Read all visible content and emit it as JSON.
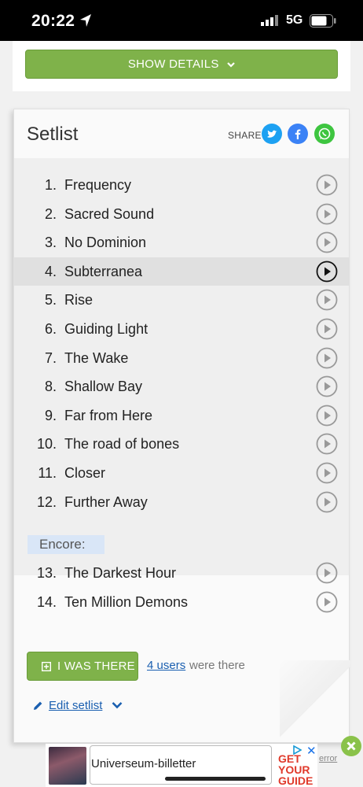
{
  "status_bar": {
    "time": "20:22",
    "network": "5G"
  },
  "show_details": {
    "label": "SHOW DETAILS"
  },
  "setlist": {
    "title": "Setlist",
    "share_label": "SHARE",
    "share_buttons": [
      {
        "name": "twitter",
        "glyph": "t",
        "color": "#1da1f2"
      },
      {
        "name": "facebook",
        "glyph": "f",
        "color": "#3b82f6"
      },
      {
        "name": "whatsapp",
        "glyph": "w",
        "color": "#3ec540"
      }
    ],
    "songs": [
      {
        "num": "1.",
        "title": "Frequency"
      },
      {
        "num": "2.",
        "title": "Sacred Sound"
      },
      {
        "num": "3.",
        "title": "No Dominion"
      },
      {
        "num": "4.",
        "title": "Subterranea"
      },
      {
        "num": "5.",
        "title": "Rise"
      },
      {
        "num": "6.",
        "title": "Guiding Light"
      },
      {
        "num": "7.",
        "title": "The Wake"
      },
      {
        "num": "8.",
        "title": "Shallow Bay"
      },
      {
        "num": "9.",
        "title": "Far from Here"
      },
      {
        "num": "10.",
        "title": "The road of bones"
      },
      {
        "num": "11.",
        "title": "Closer"
      },
      {
        "num": "12.",
        "title": "Further Away"
      }
    ],
    "encore_label": "Encore:",
    "encore_songs": [
      {
        "num": "13.",
        "title": "The Darkest Hour"
      },
      {
        "num": "14.",
        "title": "Ten Million Demons"
      }
    ],
    "was_there_label": "I WAS THERE",
    "users_link": "4 users",
    "users_suffix": "were there",
    "edit_label": "Edit setlist"
  },
  "ad": {
    "text": "Universeum-billetter",
    "logo_line1": "GET",
    "logo_line2": "YOUR",
    "logo_line3": "GUIDE",
    "error_label": "error"
  },
  "colors": {
    "accent_green": "#7fb24a",
    "link_blue": "#1a5fb0",
    "encore_bg": "#d9e6f7"
  }
}
